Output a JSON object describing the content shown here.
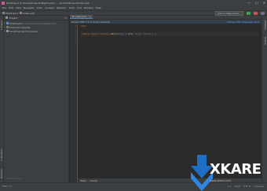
{
  "titlebar": {
    "title": "PhpProject [C:\\Users\\Project1\\PhpProject] - ...\\src\\PhpProject\\index.php",
    "minimize": "—",
    "maximize": "☐",
    "close": "✕"
  },
  "menu": [
    "File",
    "Edit",
    "View",
    "Navigate",
    "Code",
    "Analyze",
    "Refactor",
    "Tools",
    "VCS",
    "Window",
    "Help"
  ],
  "nav": {
    "crumbs": [
      "PhpProject",
      "index.php"
    ],
    "run_config": "Add Configuration..."
  },
  "project_panel": {
    "title": "Project",
    "rows": [
      {
        "label": "PhpProject",
        "path": "C:\\Users\\Project1\\PhpProject",
        "kind": "mod",
        "arrow": "▾"
      },
      {
        "label": "External Libraries",
        "path": "",
        "kind": "lib",
        "arrow": "▸"
      },
      {
        "label": "Scratches and Consoles",
        "path": "",
        "kind": "fold",
        "arrow": "▸"
      }
    ],
    "watermark": "FileHorse.com"
  },
  "left_tabs": [
    "1: Project",
    "2: Structure",
    "Favorites"
  ],
  "editor": {
    "tab_label": "index.php",
    "tab_close": "✕",
    "banner_text": "Project PHP 7.0 (7.0.31) selected",
    "banner_link": "Change PHP language level",
    "line_numbers": [
      "1",
      "2",
      "3",
      "4",
      "5"
    ],
    "code": {
      "line1_kw": "<?php",
      "line3_a": "  public static function ",
      "line3_fn": "main",
      "line3_b": "(",
      "line3_c": "$args",
      "line3_d": ") { echo ",
      "line3_str": "\"Hello, World!\"",
      "line3_e": "; }"
    },
    "bottom_crumbs": [
      "\\Main",
      "main()"
    ]
  },
  "right_tabs": [
    "Database",
    "SciView"
  ],
  "status": {
    "left": [
      "PHP 7.0"
    ],
    "right": [
      "1:1",
      "CRLF",
      "UTF-8",
      "4 spaces"
    ]
  },
  "logo": {
    "text": "XKARE",
    "sub": "www.xkare.com"
  },
  "colors": {
    "accent": "#4a88c7",
    "logo_blue": "#1e6fc4"
  }
}
